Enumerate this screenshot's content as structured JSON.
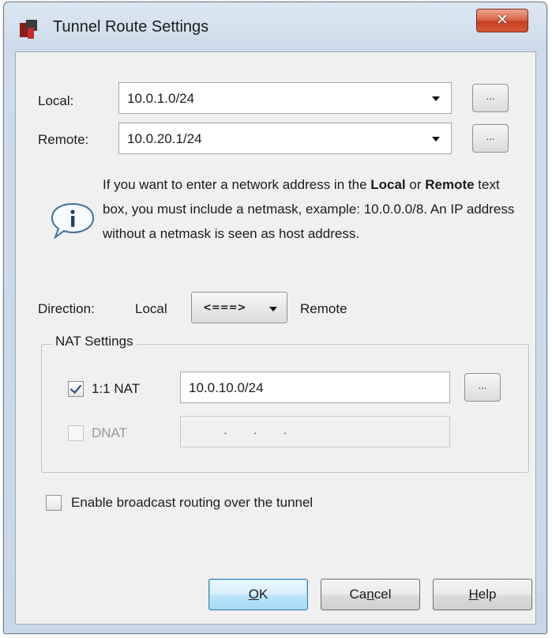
{
  "window": {
    "title": "Tunnel Route Settings",
    "close_glyph": "✕",
    "icon": "app-icon"
  },
  "local": {
    "label": "Local:",
    "value": "10.0.1.0/24",
    "browse_label": "..."
  },
  "remote": {
    "label": "Remote:",
    "value": "10.0.20.1/24",
    "browse_label": "..."
  },
  "info": {
    "icon": "info-icon",
    "text_1": "If you want to enter a network address in the ",
    "bold_1": "Local",
    "text_2": " or ",
    "bold_2": "Remote",
    "text_3": " text box, you must include a netmask, example: 10.0.0.0/8. An IP address without a netmask is seen as host address."
  },
  "direction": {
    "label": "Direction:",
    "left_label": "Local",
    "value": "<===>",
    "right_label": "Remote"
  },
  "nat": {
    "group_title": "NAT Settings",
    "one_to_one": {
      "label": "1:1 NAT",
      "checked": true,
      "value": "10.0.10.0/24",
      "browse_label": "..."
    },
    "dnat": {
      "label": "DNAT",
      "checked": false,
      "enabled": false,
      "value": ".       .       ."
    }
  },
  "broadcast": {
    "label": "Enable broadcast routing over the tunnel",
    "checked": false
  },
  "buttons": {
    "ok": {
      "mnemonic": "O",
      "rest": "K"
    },
    "cancel": {
      "pre": "Ca",
      "mnemonic": "n",
      "rest": "cel"
    },
    "help": {
      "mnemonic": "H",
      "rest": "elp"
    }
  },
  "colors": {
    "close_button": "#c6401f",
    "default_button_border": "#3c7fb1",
    "window_frame": "#cddbea"
  }
}
